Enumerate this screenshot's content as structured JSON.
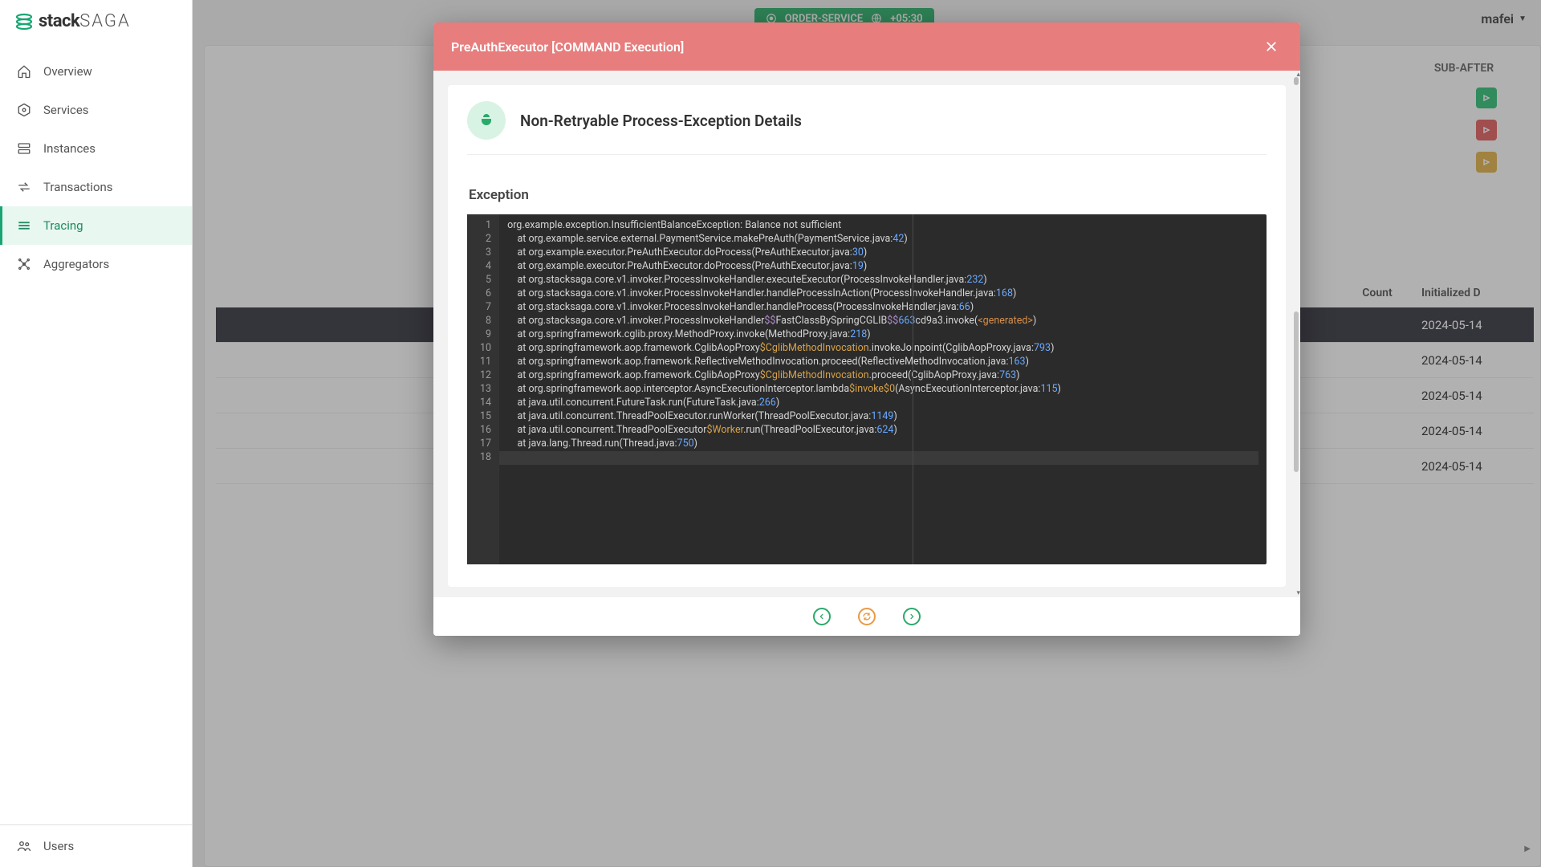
{
  "brand": {
    "bold": "stack",
    "light": "SAGA"
  },
  "nav": {
    "overview": "Overview",
    "services": "Services",
    "instances": "Instances",
    "transactions": "Transactions",
    "tracing": "Tracing",
    "aggregators": "Aggregators",
    "users": "Users"
  },
  "topbar": {
    "service": "ORDER-SERVICE",
    "tz": "+05:30",
    "user": "mafei"
  },
  "bg": {
    "col_sub_after": "SUB-AFTER",
    "th_count": "Count",
    "th_date": "Initialized D",
    "rows": [
      {
        "date": "2024-05-14"
      },
      {
        "date": "2024-05-14"
      },
      {
        "date": "2024-05-14"
      },
      {
        "date": "2024-05-14"
      },
      {
        "date": "2024-05-14"
      }
    ]
  },
  "modal": {
    "title": "PreAuthExecutor [COMMAND Execution]",
    "section_title": "Non-Retryable Process-Exception Details",
    "exception_label": "Exception",
    "trace": [
      {
        "n": 1,
        "pre": "org.example.exception.InsufficientBalanceException: Balance not sufficient"
      },
      {
        "n": 2,
        "pre": "    at org.example.service.external.PaymentService.makePreAuth(PaymentService.java:",
        "num": "42",
        "post": ")"
      },
      {
        "n": 3,
        "pre": "    at org.example.executor.PreAuthExecutor.doProcess(PreAuthExecutor.java:",
        "num": "30",
        "post": ")"
      },
      {
        "n": 4,
        "pre": "    at org.example.executor.PreAuthExecutor.doProcess(PreAuthExecutor.java:",
        "num": "19",
        "post": ")"
      },
      {
        "n": 5,
        "pre": "    at org.stacksaga.core.v1.invoker.ProcessInvokeHandler.executeExecutor(ProcessInvokeHandler.java:",
        "num": "232",
        "post": ")"
      },
      {
        "n": 6,
        "pre": "    at org.stacksaga.core.v1.invoker.ProcessInvokeHandler.handleProcessInAction(ProcessInvokeHandler.java:",
        "num": "168",
        "post": ")"
      },
      {
        "n": 7,
        "pre": "    at org.stacksaga.core.v1.invoker.ProcessInvokeHandler.handleProcess(ProcessInvokeHandler.java:",
        "num": "66",
        "post": ")"
      },
      {
        "n": 8,
        "pre": "    at org.stacksaga.core.v1.invoker.ProcessInvokeHandler",
        "sym": "$$",
        "mid": "FastClassBySpringCGLIB",
        "sym2": "$$",
        "num": "663",
        "mid2": "cd9a3.invoke(",
        "ang": "<generated>",
        "post": ")"
      },
      {
        "n": 9,
        "pre": "    at org.springframework.cglib.proxy.MethodProxy.invoke(MethodProxy.java:",
        "num": "218",
        "post": ")"
      },
      {
        "n": 10,
        "pre": "    at org.springframework.aop.framework.CglibAopProxy",
        "cls": "$CglibMethodInvocation",
        "mid": ".invokeJoinpoint(CglibAopProxy.java:",
        "num": "793",
        "post": ")"
      },
      {
        "n": 11,
        "pre": "    at org.springframework.aop.framework.ReflectiveMethodInvocation.proceed(ReflectiveMethodInvocation.java:",
        "num": "163",
        "post": ")"
      },
      {
        "n": 12,
        "pre": "    at org.springframework.aop.framework.CglibAopProxy",
        "cls": "$CglibMethodInvocation",
        "mid": ".proceed(CglibAopProxy.java:",
        "num": "763",
        "post": ")"
      },
      {
        "n": 13,
        "pre": "    at org.springframework.aop.interceptor.AsyncExecutionInterceptor.lambda",
        "cls": "$invoke$0",
        "mid": "(AsyncExecutionInterceptor.java:",
        "num": "115",
        "post": ")"
      },
      {
        "n": 14,
        "pre": "    at java.util.concurrent.FutureTask.run(FutureTask.java:",
        "num": "266",
        "post": ")"
      },
      {
        "n": 15,
        "pre": "    at java.util.concurrent.ThreadPoolExecutor.runWorker(ThreadPoolExecutor.java:",
        "num": "1149",
        "post": ")"
      },
      {
        "n": 16,
        "pre": "    at java.util.concurrent.ThreadPoolExecutor",
        "cls": "$Worker",
        "mid": ".run(ThreadPoolExecutor.java:",
        "num": "624",
        "post": ")"
      },
      {
        "n": 17,
        "pre": "    at java.lang.Thread.run(Thread.java:",
        "num": "750",
        "post": ")"
      },
      {
        "n": 18,
        "pre": ""
      }
    ]
  }
}
